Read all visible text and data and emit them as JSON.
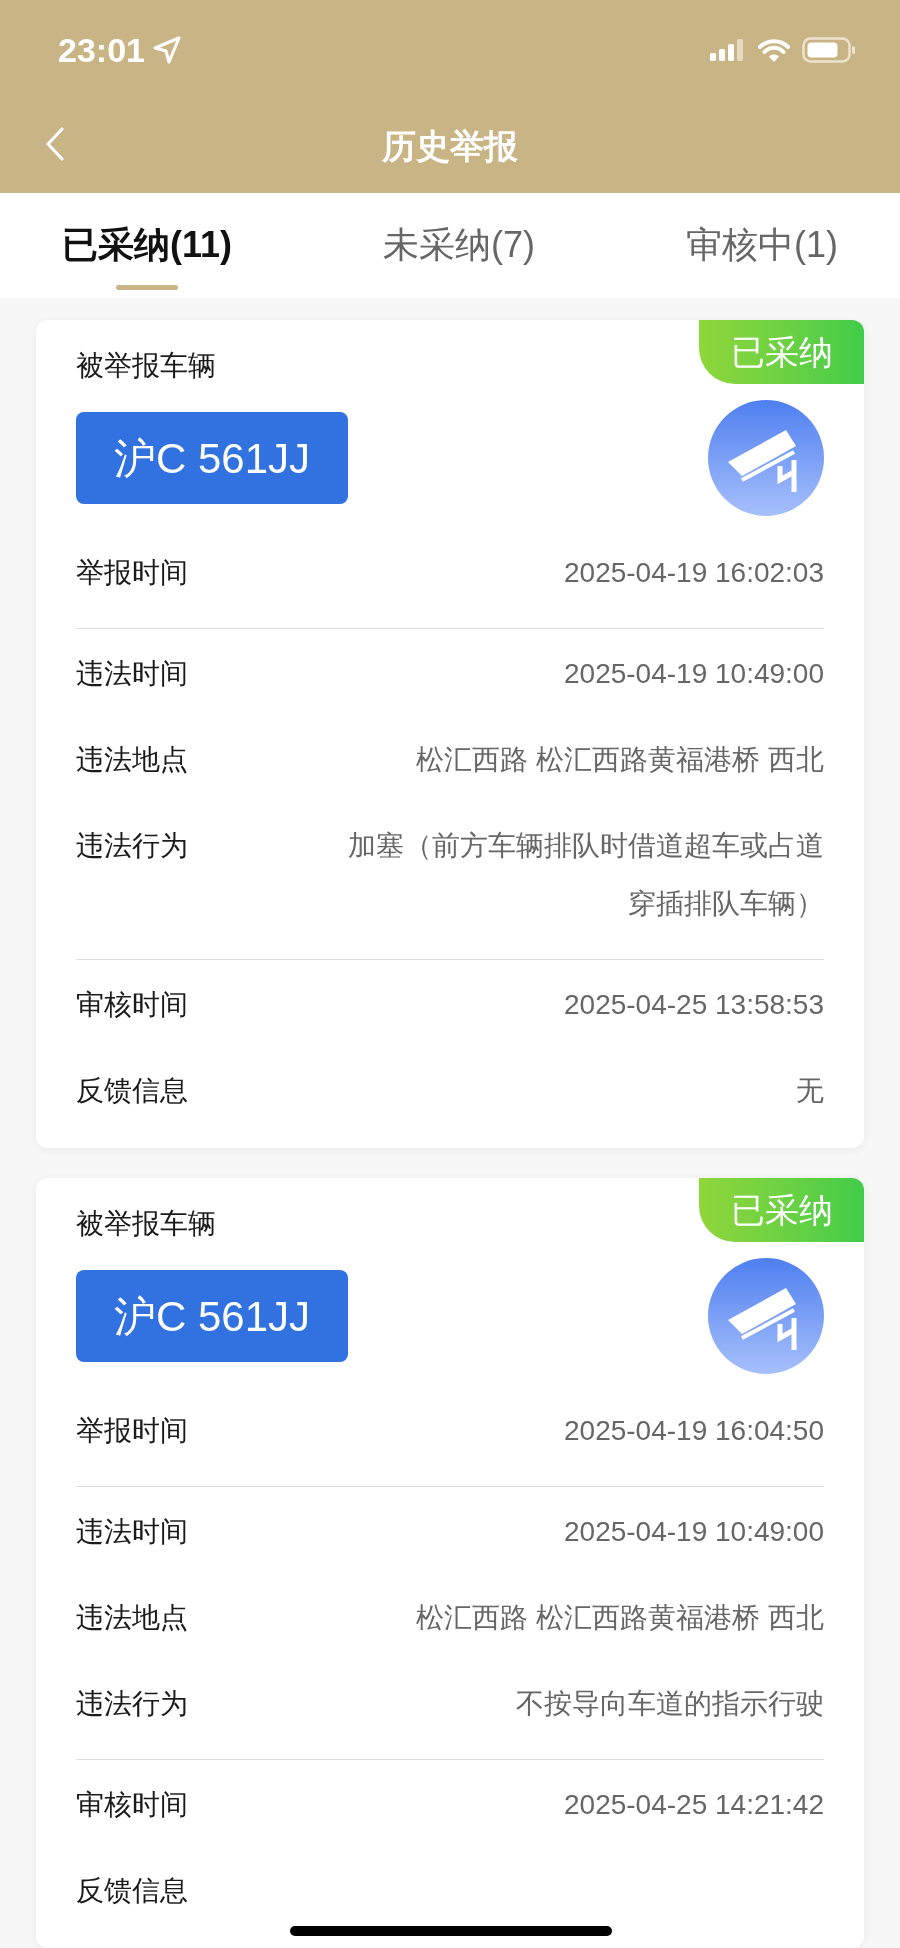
{
  "status_bar": {
    "time": "23:01"
  },
  "nav": {
    "title": "历史举报"
  },
  "tabs": [
    {
      "label": "已采纳(11)",
      "selected": true
    },
    {
      "label": "未采纳(7)",
      "selected": false
    },
    {
      "label": "审核中(1)",
      "selected": false
    }
  ],
  "cards": [
    {
      "status": "已采纳",
      "vehicle_label": "被举报车辆",
      "plate": "沪C 561JJ",
      "groups": [
        [
          {
            "label": "举报时间",
            "value": "2025-04-19 16:02:03"
          }
        ],
        [
          {
            "label": "违法时间",
            "value": "2025-04-19 10:49:00"
          },
          {
            "label": "违法地点",
            "value": "松汇西路 松汇西路黄福港桥 西北"
          },
          {
            "label": "违法行为",
            "value": "加塞（前方车辆排队时借道超车或占道穿插排队车辆）"
          }
        ],
        [
          {
            "label": "审核时间",
            "value": "2025-04-25 13:58:53"
          },
          {
            "label": "反馈信息",
            "value": "无"
          }
        ]
      ]
    },
    {
      "status": "已采纳",
      "vehicle_label": "被举报车辆",
      "plate": "沪C 561JJ",
      "groups": [
        [
          {
            "label": "举报时间",
            "value": "2025-04-19 16:04:50"
          }
        ],
        [
          {
            "label": "违法时间",
            "value": "2025-04-19 10:49:00"
          },
          {
            "label": "违法地点",
            "value": "松汇西路 松汇西路黄福港桥 西北"
          },
          {
            "label": "违法行为",
            "value": "不按导向车道的指示行驶"
          }
        ],
        [
          {
            "label": "审核时间",
            "value": "2025-04-25 14:21:42"
          },
          {
            "label": "反馈信息"
          }
        ]
      ]
    }
  ]
}
